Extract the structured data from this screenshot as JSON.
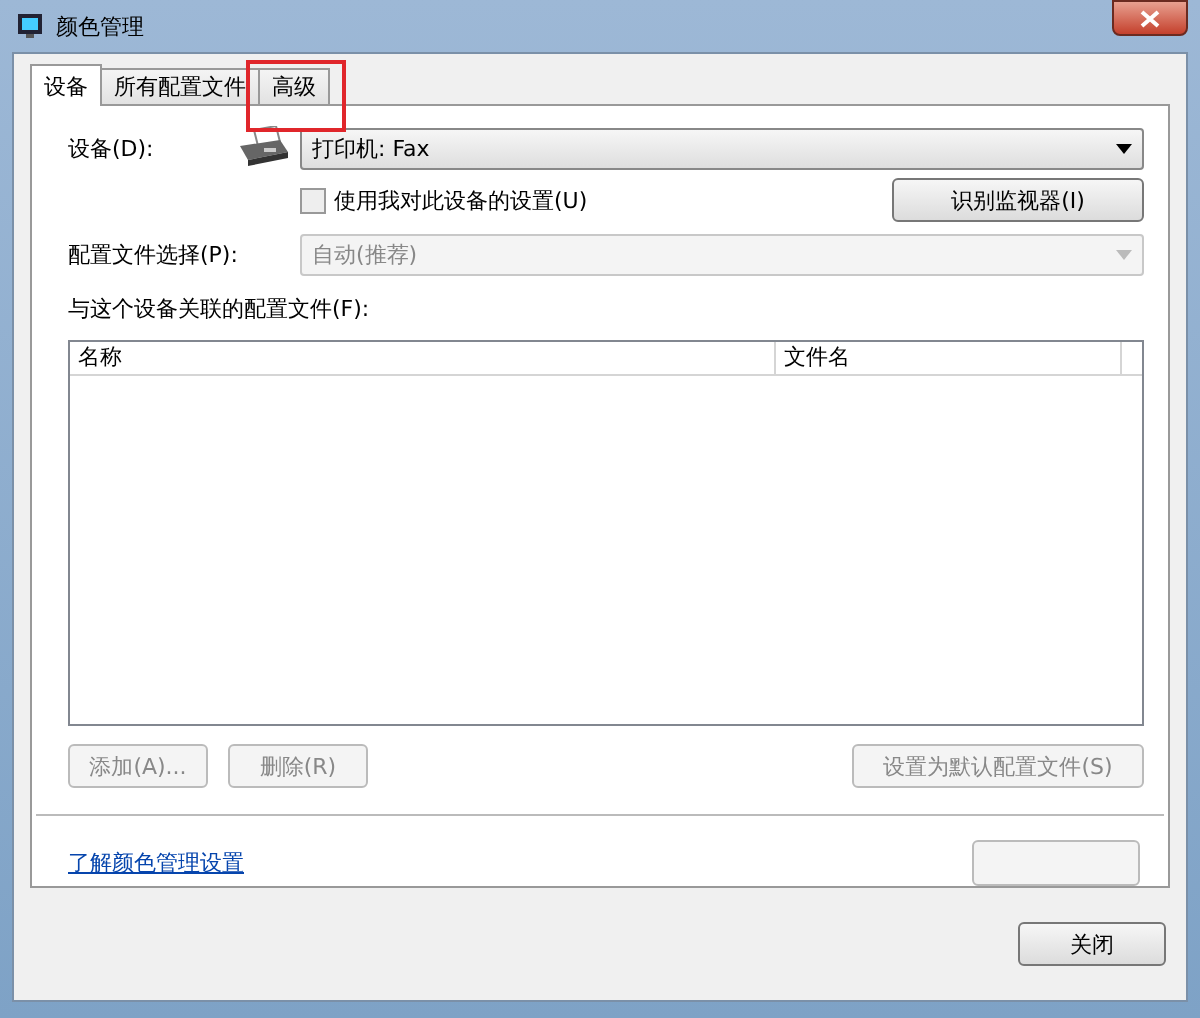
{
  "window": {
    "title": "颜色管理"
  },
  "tabs": [
    {
      "label": "设备",
      "selected": true
    },
    {
      "label": "所有配置文件",
      "selected": false
    },
    {
      "label": "高级",
      "selected": false,
      "highlighted": true
    }
  ],
  "device": {
    "label": "设备(D):",
    "value": "打印机: Fax"
  },
  "use_my_settings": {
    "label": "使用我对此设备的设置(U)",
    "checked": false
  },
  "identify_button": {
    "label": "识别监视器(I)"
  },
  "profile_selection": {
    "label": "配置文件选择(P):",
    "value": "自动(推荐)",
    "disabled": true
  },
  "profiles": {
    "label": "与这个设备关联的配置文件(F):",
    "columns": [
      "名称",
      "文件名"
    ]
  },
  "buttons": [
    {
      "label": "添加(A)...",
      "disabled": true
    },
    {
      "label": "删除(R)",
      "disabled": true
    },
    {
      "label": "设置为默认配置文件(S)",
      "disabled": true
    }
  ],
  "link": "了解颜色管理设置",
  "close_button": {
    "label": "关闭"
  }
}
